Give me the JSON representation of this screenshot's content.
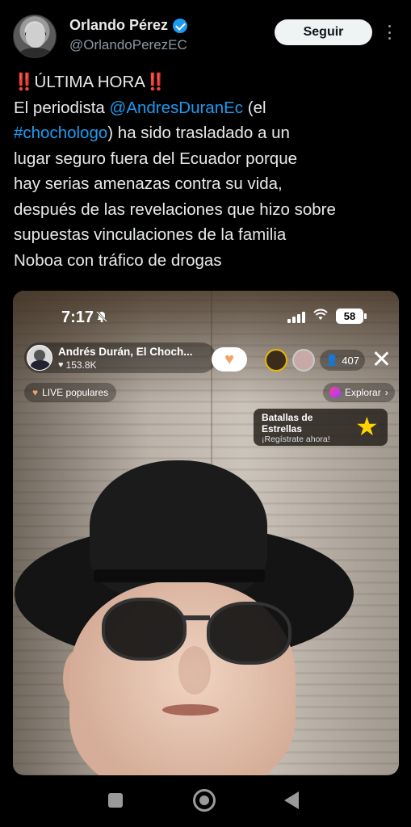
{
  "tweet": {
    "author_name": "Orlando Pérez",
    "author_handle": "@OrlandoPerezEC",
    "follow_label": "Seguir",
    "text": {
      "line1_prefix": "‼️",
      "line1_title": "ÚLTIMA HORA",
      "line1_suffix": "‼️",
      "line2_pre": "El periodista ",
      "line2_mention": "@AndresDuranEc",
      "line2_post": " (el",
      "line3_hashtag": "#chochologo",
      "line3_post": ") ha sido trasladado a un",
      "line4": "lugar seguro fuera del Ecuador porque",
      "line5": "hay serias amenazas contra su vida,",
      "line6": "después de las revelaciones que hizo sobre",
      "line7": "supuestas vinculaciones de la familia",
      "line8": "Noboa con tráfico de drogas"
    }
  },
  "media": {
    "status_time": "7:17",
    "battery": "58",
    "live_name": "Andrés Durán, El Choch...",
    "live_likes": "153.8K",
    "viewer_count": "407",
    "live_popular_label": "LIVE populares",
    "explore_label": "Explorar",
    "battle_title": "Batallas de Estrellas",
    "battle_sub": "¡Regístrate ahora!"
  },
  "icons": {
    "verified": "verified-badge-icon",
    "more": "more-options-icon",
    "star": "star-icon",
    "close": "close-icon"
  },
  "colors": {
    "link": "#1d9bf0",
    "verified": "#1d9bf0",
    "background": "#000000"
  }
}
